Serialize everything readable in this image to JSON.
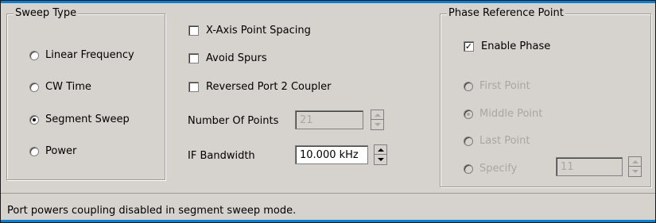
{
  "sweep_type": {
    "title": "Sweep Type",
    "options": [
      {
        "label": "Linear Frequency",
        "checked": false
      },
      {
        "label": "CW Time",
        "checked": false
      },
      {
        "label": "Segment Sweep",
        "checked": true
      },
      {
        "label": "Power",
        "checked": false
      }
    ]
  },
  "options": {
    "x_axis_point_spacing": "X-Axis Point Spacing",
    "avoid_spurs": "Avoid Spurs",
    "reversed_port2_coupler": "Reversed Port 2 Coupler"
  },
  "number_of_points": {
    "label": "Number Of Points",
    "value": "21"
  },
  "if_bandwidth": {
    "label": "IF Bandwidth",
    "value": "10.000 kHz"
  },
  "phase_reference": {
    "title": "Phase Reference Point",
    "enable_label": "Enable Phase",
    "enable_checked": true,
    "options": [
      {
        "label": "First Point",
        "checked": false
      },
      {
        "label": "Middle Point",
        "checked": true
      },
      {
        "label": "Last Point",
        "checked": false
      },
      {
        "label": "Specify",
        "checked": false
      }
    ],
    "specify_value": "11"
  },
  "status_message": "Port powers coupling disabled in segment sweep mode.",
  "colors": {
    "background": "#d6d3ce",
    "accent": "#0b7fd1",
    "disabled_text": "#a9a7a2"
  }
}
